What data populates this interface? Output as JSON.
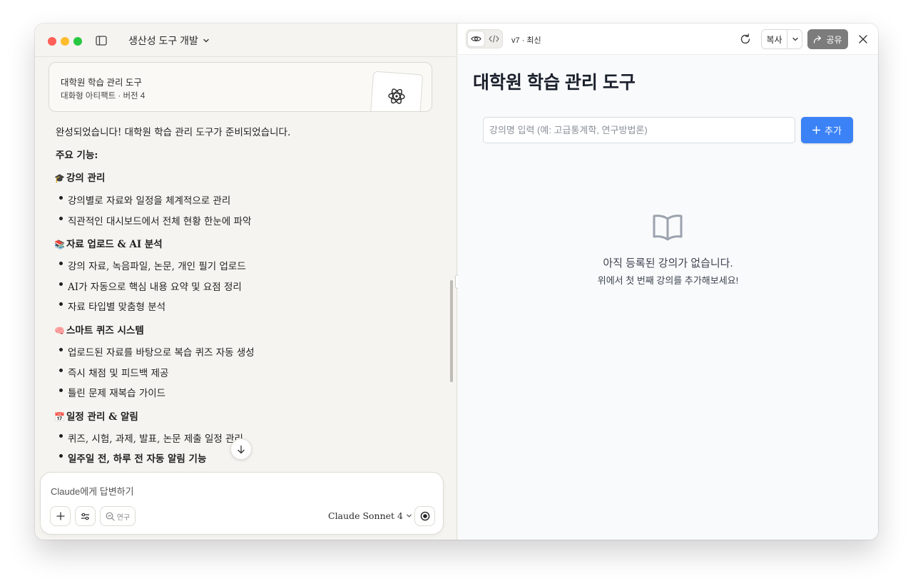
{
  "window": {
    "project_title": "생산성 도구 개발"
  },
  "artifact_card": {
    "title": "대학원 학습 관리 도구",
    "subtitle": "대화형 아티팩트 · 버전 4"
  },
  "chat": {
    "intro": "완성되었습니다! 대학원 학습 관리 도구가 준비되었습니다.",
    "features_heading": "주요 기능:",
    "sections": [
      {
        "emoji": "🎓",
        "title": "강의 관리",
        "items": [
          "강의별로 자료와 일정을 체계적으로 관리",
          "직관적인 대시보드에서 전체 현황 한눈에 파악"
        ]
      },
      {
        "emoji": "📚",
        "title": "자료 업로드 & AI 분석",
        "items": [
          "강의 자료, 녹음파일, 논문, 개인 필기 업로드",
          "AI가 자동으로 핵심 내용 요약 및 요점 정리",
          "자료 타입별 맞춤형 분석"
        ]
      },
      {
        "emoji": "🧠",
        "title": "스마트 퀴즈 시스템",
        "items": [
          "업로드된 자료를 바탕으로 복습 퀴즈 자동 생성",
          "즉시 채점 및 피드백 제공",
          "틀린 문제 재복습 가이드"
        ]
      },
      {
        "emoji": "📅",
        "title": "일정 관리 & 알림",
        "items": [
          "퀴즈, 시험, 과제, 발표, 논문 제출 일정 관리",
          "일주일 전, 하루 전 자동 알림 기능"
        ]
      }
    ]
  },
  "composer": {
    "placeholder": "Claude에게 답변하기",
    "research_label": "연구",
    "model": "Claude Sonnet 4"
  },
  "artifact_toolbar": {
    "version": "v7 · 최신",
    "copy_label": "복사",
    "share_label": "공유"
  },
  "app": {
    "title": "대학원 학습 관리 도구",
    "course_input_placeholder": "강의명 입력 (예: 고급통계학, 연구방법론)",
    "add_button": "추가",
    "empty_title": "아직 등록된 강의가 없습니다.",
    "empty_sub": "위에서 첫 번째 강의를 추가해보세요!",
    "accent_color": "#3b82f6"
  }
}
